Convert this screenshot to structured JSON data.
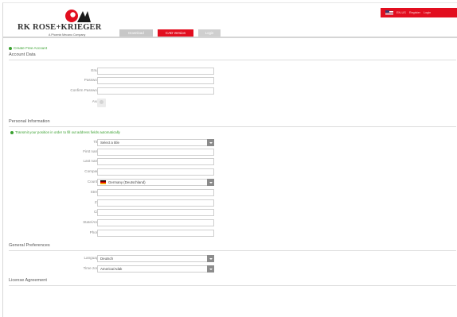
{
  "brand": {
    "name": "RK ROSE+KRIEGER",
    "tagline": "A Phoenix Mecano Company"
  },
  "tabs": [
    {
      "label": "Download"
    },
    {
      "label": "CAD Version"
    },
    {
      "label": "Login"
    }
  ],
  "topbar": {
    "language": "EN-US",
    "links": [
      "Register",
      "Login"
    ]
  },
  "create_link": "Create Free Account",
  "account": {
    "title": "Account Data",
    "email_label": "Email",
    "password_label": "Password",
    "confirm_password_label": "Confirm Password",
    "avatar_label": "Avatar"
  },
  "personal": {
    "title": "Personal Information",
    "hint": "Transmit your position in order to fill out address fields automatically",
    "title_label": "Title",
    "title_value": "Select a title",
    "first_name_label": "First name",
    "last_name_label": "Last name",
    "company_label": "Company",
    "country_label": "Country",
    "country_value": "Germany (Deutschland)",
    "street_label": "Street",
    "zip_label": "ZIP",
    "city_label": "City",
    "state_label": "State/Area",
    "phone_label": "Phone"
  },
  "preferences": {
    "title": "General Preferences",
    "language_label": "Language",
    "language_value": "Deutsch",
    "timezone_label": "Time zone",
    "timezone_value": "America/Adak"
  },
  "license": {
    "title": "License Agreement"
  },
  "required_mark": "*",
  "colors": {
    "accent": "#e20e1f",
    "success": "#3aa030",
    "tab_inactive": "#c7c7c7"
  }
}
